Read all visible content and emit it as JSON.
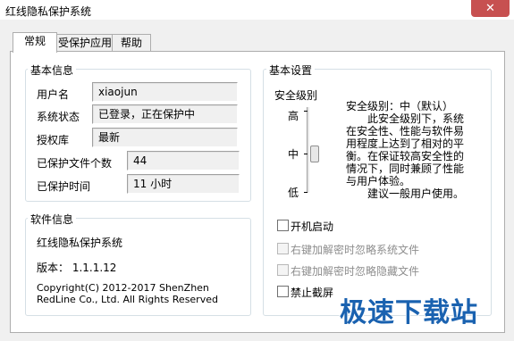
{
  "window": {
    "title": "红线隐私保护系统",
    "close_glyph": "✕"
  },
  "tabs": [
    {
      "label": "常规"
    },
    {
      "label": "受保护应用"
    },
    {
      "label": "帮助"
    }
  ],
  "basic_info": {
    "title": "基本信息",
    "rows": [
      {
        "label": "用户名",
        "value": "xiaojun"
      },
      {
        "label": "系统状态",
        "value": "已登录，正在保护中"
      },
      {
        "label": "授权库",
        "value": "最新"
      },
      {
        "label": "已保护文件个数",
        "value": "44"
      },
      {
        "label": "已保护时间",
        "value": "11 小时"
      }
    ]
  },
  "software_info": {
    "title": "软件信息",
    "name": "红线隐私保护系统",
    "version": "版本： 1.1.1.12",
    "copyright": "Copyright(C) 2012-2017 ShenZhen RedLine Co., Ltd. All Rights Reserved"
  },
  "settings": {
    "title": "基本设置",
    "security_level_label": "安全级别",
    "levels": {
      "high": "高",
      "mid": "中",
      "low": "低"
    },
    "slider_value": "中",
    "description": "安全级别：中（默认）\n　　此安全级别下，系统在安全性、性能与软件易用程度上达到了相对的平衡。在保证较高安全性的情况下，同时兼顾了性能与用户体验。\n　　建议一般用户使用。",
    "checkboxes": [
      {
        "label": "开机启动",
        "checked": false,
        "enabled": true
      },
      {
        "label": "右键加解密时忽略系统文件",
        "checked": false,
        "enabled": false
      },
      {
        "label": "右键加解密时忽略隐藏文件",
        "checked": false,
        "enabled": false
      },
      {
        "label": "禁止截屏",
        "checked": false,
        "enabled": true
      }
    ]
  },
  "watermark": "极速下载站"
}
